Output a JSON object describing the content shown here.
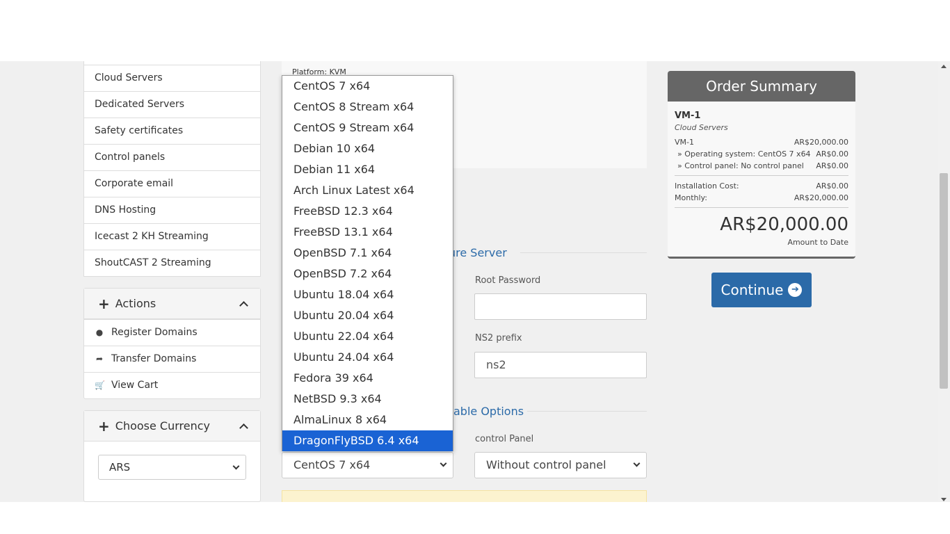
{
  "categories": [
    "Cloud Servers",
    "Dedicated Servers",
    "Safety certificates",
    "Control panels",
    "Corporate email",
    "DNS Hosting",
    "Icecast 2 KH Streaming",
    "ShoutCAST 2 Streaming"
  ],
  "actions": {
    "title": "Actions",
    "items": [
      {
        "icon": "globe-icon",
        "label": "Register Domains"
      },
      {
        "icon": "share-icon",
        "label": "Transfer Domains"
      },
      {
        "icon": "cart-icon",
        "label": "View Cart"
      }
    ]
  },
  "currency": {
    "title": "Choose Currency",
    "selected": "ARS"
  },
  "product": {
    "platform": "Platform: KVM"
  },
  "configure": {
    "section_title": "ure Server",
    "root_password_label": "Root Password",
    "root_password_value": "",
    "ns2_label": "NS2 prefix",
    "ns2_value": "ns2"
  },
  "options": {
    "section_title": "able Options",
    "os_selected": "CentOS 7 x64",
    "control_panel_label": "control Panel",
    "control_panel_selected": "Without control panel"
  },
  "os_dropdown": {
    "options": [
      "CentOS 7 x64",
      "CentOS 8 Stream x64",
      "CentOS 9 Stream x64",
      "Debian 10 x64",
      "Debian 11 x64",
      "Arch Linux Latest x64",
      "FreeBSD 12.3 x64",
      "FreeBSD 13.1 x64",
      "OpenBSD 7.1 x64",
      "OpenBSD 7.2 x64",
      "Ubuntu 18.04 x64",
      "Ubuntu 20.04 x64",
      "Ubuntu 22.04 x64",
      "Ubuntu 24.04 x64",
      "Fedora 39 x64",
      "NetBSD 9.3 x64",
      "AlmaLinux 8 x64",
      "DragonFlyBSD 6.4 x64"
    ],
    "highlighted": "DragonFlyBSD 6.4 x64"
  },
  "summary": {
    "title": "Order Summary",
    "product_name": "VM-1",
    "product_group": "Cloud Servers",
    "line_item": {
      "label": "VM-1",
      "value": "AR$20,000.00"
    },
    "sub_items": [
      {
        "label": "» Operating system: CentOS 7 x64",
        "value": "AR$0.00"
      },
      {
        "label": "» Control panel: No control panel",
        "value": "AR$0.00"
      }
    ],
    "installation": {
      "label": "Installation Cost:",
      "value": "AR$0.00"
    },
    "monthly": {
      "label": "Monthly:",
      "value": "AR$20,000.00"
    },
    "total": "AR$20,000.00",
    "total_label": "Amount to Date"
  },
  "continue_label": "Continue",
  "colors": {
    "accent": "#2b6aa8",
    "highlight": "#1a63d4",
    "summary_header": "#666666"
  }
}
